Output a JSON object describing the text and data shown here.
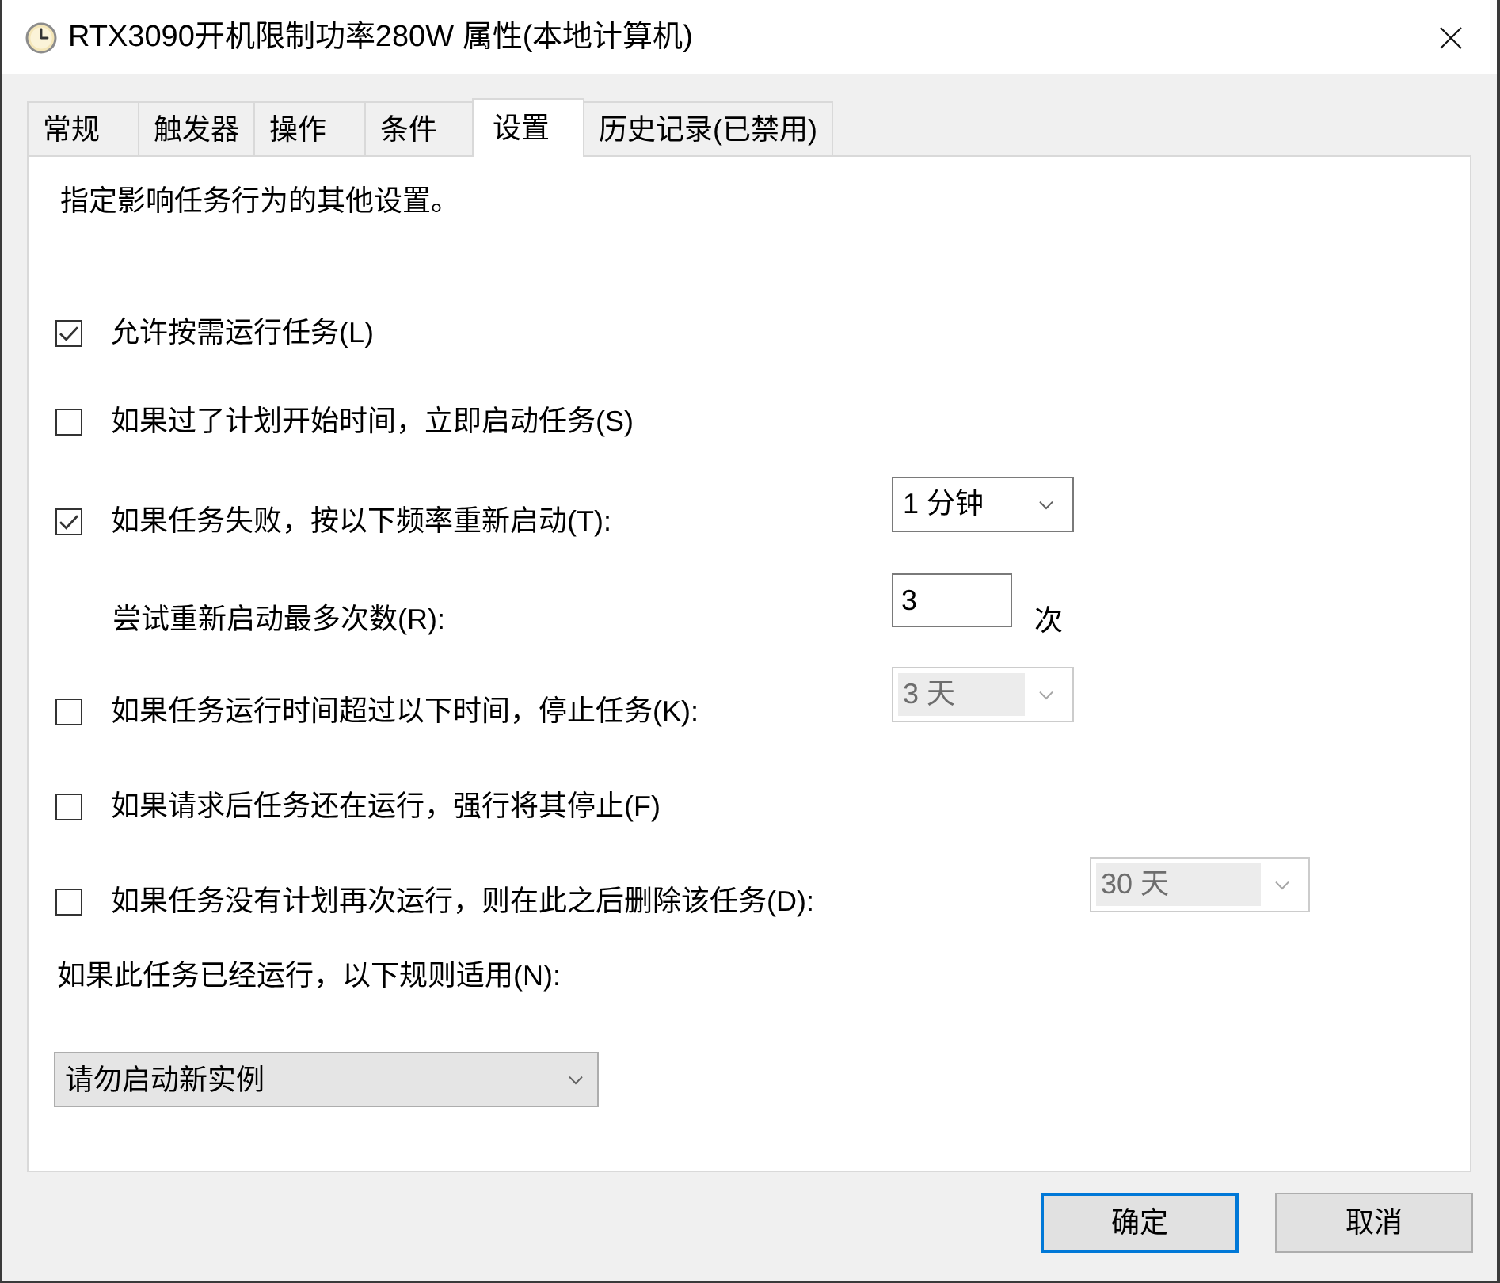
{
  "window": {
    "title": "RTX3090开机限制功率280W 属性(本地计算机)"
  },
  "tabs": [
    {
      "label": "常规",
      "selected": false
    },
    {
      "label": "触发器",
      "selected": false
    },
    {
      "label": "操作",
      "selected": false
    },
    {
      "label": "条件",
      "selected": false
    },
    {
      "label": "设置",
      "selected": true
    },
    {
      "label": "历史记录(已禁用)",
      "selected": false
    }
  ],
  "settings": {
    "description": "指定影响任务行为的其他设置。",
    "rows": [
      {
        "kind": "checkbox",
        "label": "允许按需运行任务(L)",
        "checked": true
      },
      {
        "kind": "checkbox",
        "label": "如果过了计划开始时间，立即启动任务(S)",
        "checked": false
      },
      {
        "kind": "checkbox",
        "label": "如果任务失败，按以下频率重新启动(T):",
        "checked": true,
        "dropdown": {
          "value": "1 分钟",
          "disabled": false
        }
      },
      {
        "kind": "number",
        "label": "尝试重新启动最多次数(R):",
        "value": "3",
        "unit": "次"
      },
      {
        "kind": "checkbox",
        "label": "如果任务运行时间超过以下时间，停止任务(K):",
        "checked": false,
        "dropdown": {
          "value": "3 天",
          "disabled": true
        }
      },
      {
        "kind": "checkbox",
        "label": "如果请求后任务还在运行，强行将其停止(F)",
        "checked": false
      },
      {
        "kind": "checkbox",
        "label": "如果任务没有计划再次运行，则在此之后删除该任务(D):",
        "checked": false,
        "dropdown": {
          "value": "30 天",
          "disabled": true
        }
      },
      {
        "kind": "label",
        "label": "如果此任务已经运行，以下规则适用(N):"
      },
      {
        "kind": "select",
        "value": "请勿启动新实例"
      }
    ]
  },
  "buttons": [
    {
      "label": "确定",
      "default": true
    },
    {
      "label": "取消",
      "default": false
    }
  ]
}
